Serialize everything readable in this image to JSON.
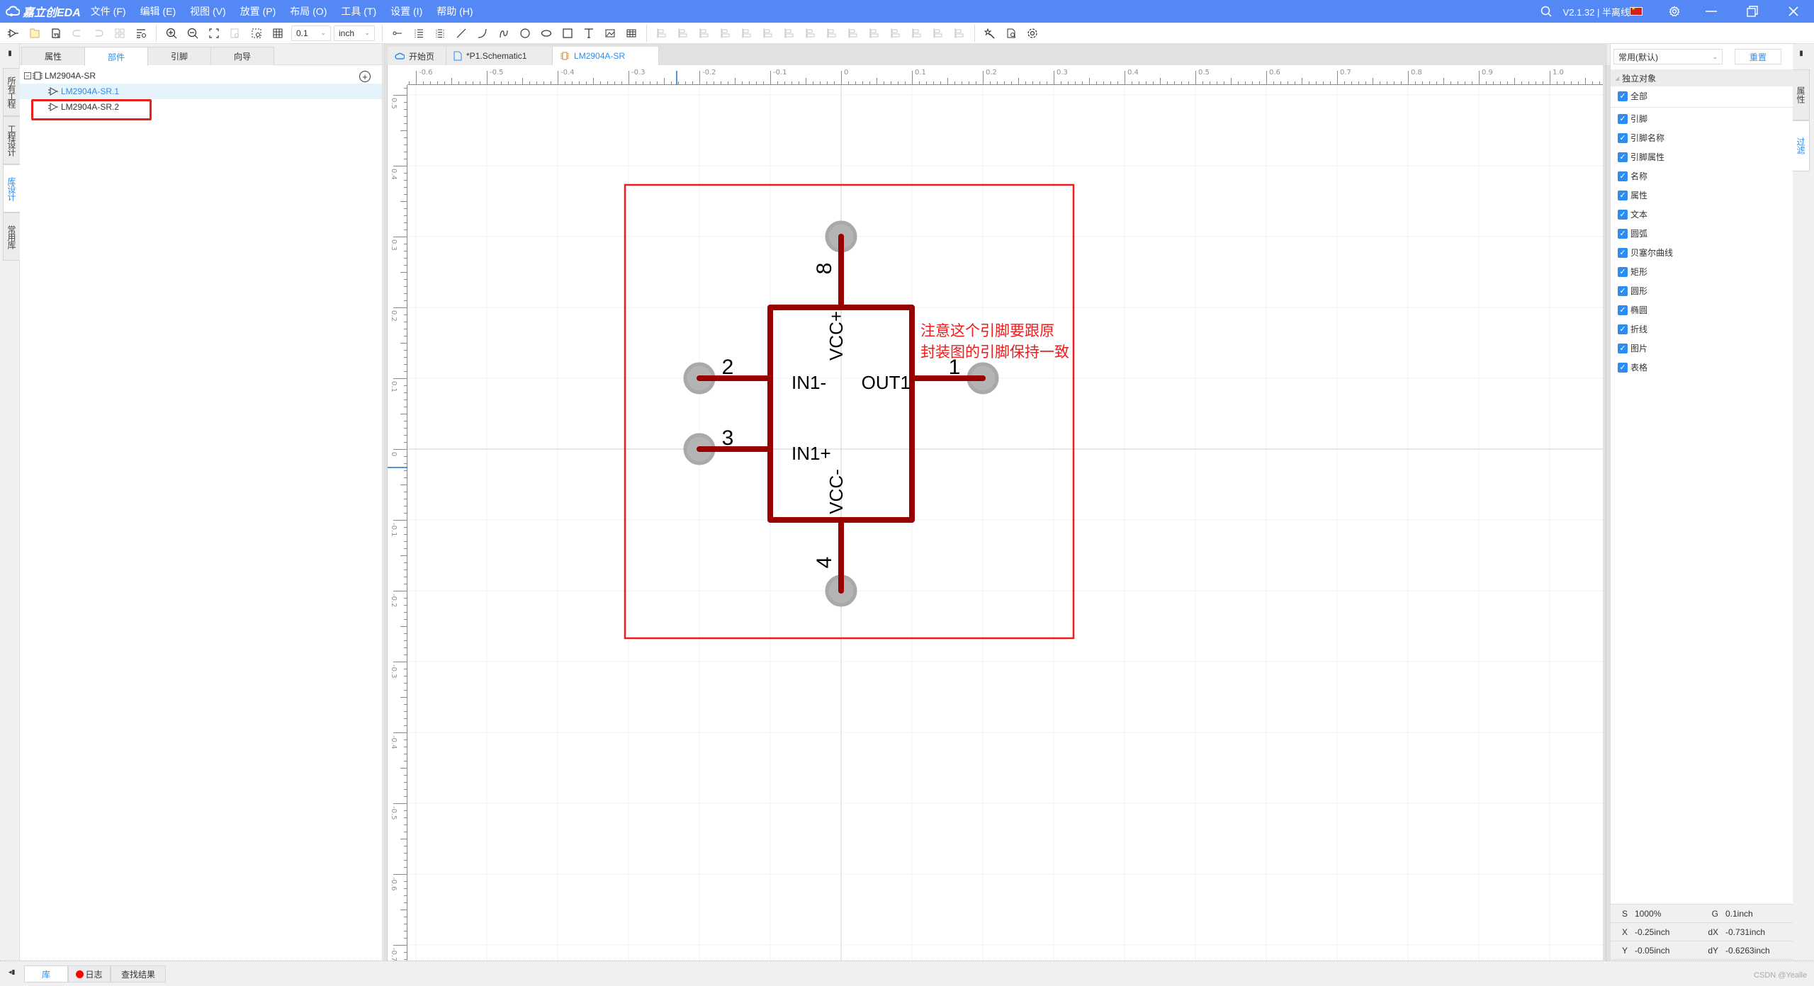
{
  "titlebar": {
    "app_name": "嘉立创EDA",
    "menu": [
      "文件 (F)",
      "编辑 (E)",
      "视图 (V)",
      "放置 (P)",
      "布局 (O)",
      "工具 (T)",
      "设置 (I)",
      "帮助 (H)"
    ],
    "version": "V2.1.32 | 半离线",
    "icons": [
      "search-icon",
      "flag-cn-icon",
      "gear-icon",
      "minimize-icon",
      "restore-icon",
      "close-icon"
    ]
  },
  "toolbar": {
    "grid_value": "0.1",
    "unit_value": "inch",
    "left_tools": [
      "select-pin-icon",
      "open-folder-icon",
      "save-icon",
      "undo-icon",
      "redo-icon",
      "group-icon",
      "find-list-icon"
    ],
    "view_tools": [
      "zoom-in-icon",
      "zoom-out-icon",
      "fit-icon",
      "zoom-selection-icon",
      "zoom-area-icon",
      "grid-icon"
    ],
    "draw_tools": [
      "pin-icon",
      "pin-array-icon",
      "pin-double-array-icon",
      "line-icon",
      "arc-icon",
      "bezier-icon",
      "circle-icon",
      "ellipse-icon",
      "rectangle-icon",
      "text-icon",
      "image-icon",
      "table-icon"
    ],
    "align_tools": [
      "align-left-icon",
      "align-right-icon",
      "align-top-icon",
      "align-bottom-icon",
      "align-hcenter-icon",
      "align-vcenter-icon",
      "align-grid-icon",
      "distribute-h-icon",
      "distribute-v-icon",
      "rotate-left-icon",
      "rotate-right-icon",
      "flip-h-icon",
      "flip-v-icon",
      "bring-front-icon",
      "send-back-icon"
    ],
    "right_tools": [
      "wizard-icon",
      "check-doc-icon",
      "settings-icon"
    ]
  },
  "left_vertical_tabs": [
    "所有工程",
    "工程设计",
    "库设计",
    "常用库"
  ],
  "left_vertical_active": 2,
  "left_panel": {
    "tabs": [
      "属性",
      "部件",
      "引脚",
      "向导"
    ],
    "active_tab": 1,
    "tree": {
      "root": "LM2904A-SR",
      "children": [
        "LM2904A-SR.1",
        "LM2904A-SR.2"
      ],
      "selected": 0
    }
  },
  "doc_tabs": [
    {
      "label": "开始页",
      "icon": "home-cloud-icon"
    },
    {
      "label": "*P1.Schematic1",
      "icon": "document-icon"
    },
    {
      "label": "LM2904A-SR",
      "icon": "chip-icon",
      "active": true
    }
  ],
  "ruler": {
    "x_labels": [
      "-0.6",
      "-0.5",
      "-0.4",
      "-0.3",
      "-0.2",
      "-0.1",
      "0",
      "0.1",
      "0.2",
      "0.3",
      "0.4",
      "0.5",
      "0.6",
      "0.7",
      "0.8",
      "0.9",
      "1.0"
    ],
    "y_labels": [
      "0.5",
      "0.4",
      "0.3",
      "0.2",
      "0.1",
      "0",
      "-0.1",
      "-0.2",
      "-0.3",
      "-0.4",
      "-0.5",
      "-0.6",
      "-0.7"
    ]
  },
  "symbol": {
    "pins": [
      {
        "number": "8",
        "name": "VCC+",
        "side": "top"
      },
      {
        "number": "2",
        "name": "IN1-",
        "side": "left"
      },
      {
        "number": "3",
        "name": "IN1+",
        "side": "left"
      },
      {
        "number": "1",
        "name": "OUT1",
        "side": "right"
      },
      {
        "number": "4",
        "name": "VCC-",
        "side": "bottom"
      }
    ],
    "annotation_line1": "注意这个引脚要跟原",
    "annotation_line2": "封装图的引脚保持一致",
    "colors": {
      "body": "#990000",
      "pin_dot": "#a9a9a9",
      "frame": "#ee1c1c",
      "annotation": "#ee1c1c"
    }
  },
  "right_panel": {
    "preset": "常用(默认)",
    "reset_label": "重置",
    "section": "独立对象",
    "all_label": "全部",
    "filters": [
      "引脚",
      "引脚名称",
      "引脚属性",
      "名称",
      "属性",
      "文本",
      "圆弧",
      "贝塞尔曲线",
      "矩形",
      "圆形",
      "椭圆",
      "折线",
      "图片",
      "表格"
    ]
  },
  "right_vertical_tabs": [
    "属性",
    "过滤"
  ],
  "right_vertical_active": 1,
  "status": {
    "S": "1000%",
    "G": "0.1inch",
    "X": "-0.25inch",
    "dX": "-0.731inch",
    "Y": "-0.05inch",
    "dY": "-0.6263inch"
  },
  "bottom_tabs": [
    "库",
    "日志",
    "查找结果"
  ],
  "bottom_active": 0,
  "watermark": "CSDN @Yealle",
  "accent": "#2d8cf0",
  "titlebar_color": "#5489f5"
}
